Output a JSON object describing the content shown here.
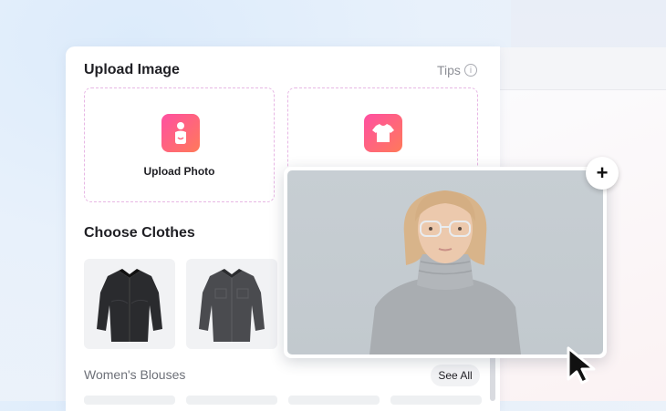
{
  "upload": {
    "title": "Upload Image",
    "tips_label": "Tips",
    "tips_icon": "info-icon",
    "photo_label": "Upload Photo",
    "photo_icon": "person-icon",
    "clothes_icon": "tshirt-icon"
  },
  "clothes": {
    "title": "Choose Clothes",
    "items": [
      {
        "name": "black-shirt",
        "icon": "shirt-icon"
      },
      {
        "name": "dark-grey-shirt",
        "icon": "shirt-icon"
      }
    ],
    "category_label": "Women's Blouses",
    "see_all_label": "See All"
  },
  "preview": {
    "add_icon": "plus-icon",
    "add_label": "+",
    "cursor_icon": "arrow-cursor-icon"
  },
  "colors": {
    "accent_start": "#ff4fa2",
    "accent_end": "#ff7a59",
    "dashed_border": "#e7b7e4"
  }
}
